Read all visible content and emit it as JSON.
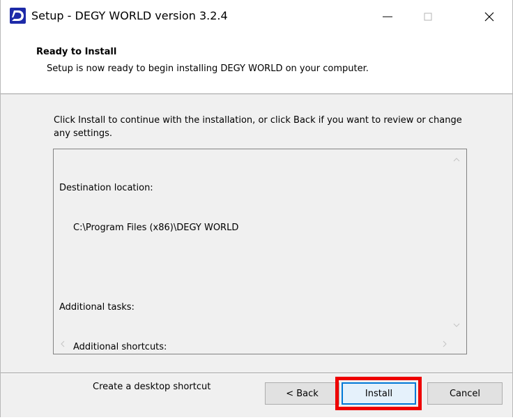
{
  "window": {
    "title": "Setup - DEGY WORLD version 3.2.4",
    "logo_icon": "degy-logo-icon",
    "controls": {
      "minimize_icon": "minimize-icon",
      "maximize_icon": "maximize-icon",
      "close_icon": "close-icon"
    }
  },
  "header": {
    "title": "Ready to Install",
    "subtitle": "Setup is now ready to begin installing DEGY WORLD on your computer."
  },
  "body": {
    "instruction": "Click Install to continue with the installation, or click Back if you want to review or change any settings.",
    "memo": {
      "lines": [
        "Destination location:",
        "C:\\Program Files (x86)\\DEGY WORLD",
        "",
        "Additional tasks:",
        "Additional shortcuts:",
        "Create a desktop shortcut"
      ]
    }
  },
  "footer": {
    "back_label": "< Back",
    "install_label": "Install",
    "cancel_label": "Cancel"
  },
  "colors": {
    "accent": "#0078d7",
    "highlight": "#ee0000",
    "logo": "#1d2aa8"
  }
}
